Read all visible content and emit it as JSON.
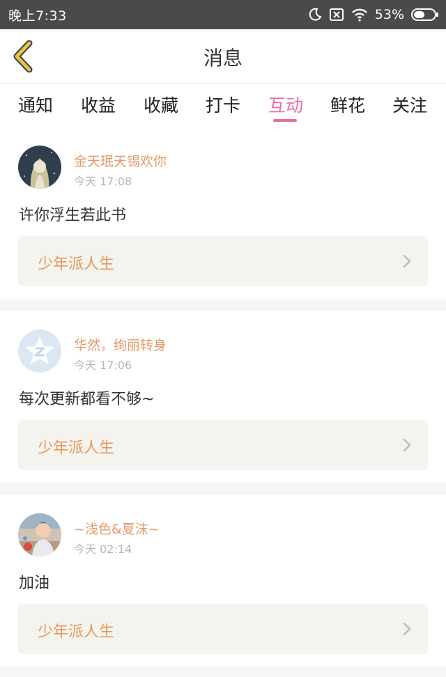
{
  "status_bar": {
    "time": "晚上7:33",
    "battery": "53%"
  },
  "header": {
    "title": "消息"
  },
  "tabs": [
    {
      "label": "通知",
      "active": false
    },
    {
      "label": "收益",
      "active": false
    },
    {
      "label": "收藏",
      "active": false
    },
    {
      "label": "打卡",
      "active": false
    },
    {
      "label": "互动",
      "active": true
    },
    {
      "label": "鲜花",
      "active": false
    },
    {
      "label": "关注",
      "active": false
    }
  ],
  "messages": [
    {
      "username": "金天珉天锡欢你",
      "time": "今天 17:08",
      "text": "许你浮生若此书",
      "book": "少年派人生",
      "avatar_icon": "illustrated-girl-avatar"
    },
    {
      "username": "华然，绚丽转身",
      "time": "今天 17:06",
      "text": "每次更新都看不够~",
      "book": "少年派人生",
      "avatar_icon": "default-star-avatar"
    },
    {
      "username": "~浅色&夏沫~",
      "time": "今天 02:14",
      "text": "加油",
      "book": "少年派人生",
      "avatar_icon": "child-photo-avatar"
    }
  ],
  "colors": {
    "accent": "#e86ea2",
    "username": "#e59a6c",
    "book_title": "#e8965f",
    "back_arrow": "#e8c24a"
  }
}
